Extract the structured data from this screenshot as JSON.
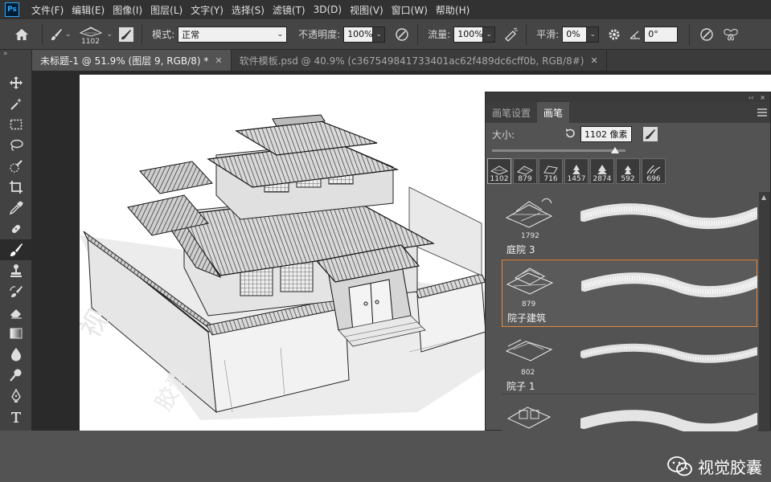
{
  "menubar": {
    "logo": "Ps",
    "items": [
      "文件(F)",
      "编辑(E)",
      "图像(I)",
      "图层(L)",
      "文字(Y)",
      "选择(S)",
      "滤镜(T)",
      "3D(D)",
      "视图(V)",
      "窗口(W)",
      "帮助(H)"
    ]
  },
  "options": {
    "brush_size": "1102",
    "mode_label": "模式:",
    "mode_value": "正常",
    "opacity_label": "不透明度:",
    "opacity_value": "100%",
    "flow_label": "流量:",
    "flow_value": "100%",
    "smooth_label": "平滑:",
    "smooth_value": "0%",
    "angle_value": "0°"
  },
  "tabs": [
    {
      "label": "未标题-1 @ 51.9% (图层 9, RGB/8) *",
      "active": true
    },
    {
      "label": "软件模板.psd @ 40.9% (c367549841733401ac62f489dc6cff0b, RGB/8#)",
      "active": false
    }
  ],
  "toolbar": {
    "collapse": "»",
    "tools": [
      "move-tool",
      "magic-wand-tool",
      "marquee-tool",
      "lasso-tool",
      "quick-selection-tool",
      "crop-tool",
      "eyedropper-tool",
      "healing-brush-tool",
      "brush-tool",
      "clone-stamp-tool",
      "history-brush-tool",
      "eraser-tool",
      "gradient-tool",
      "blur-tool",
      "dodge-tool",
      "pen-tool",
      "type-tool"
    ],
    "active_tool": "brush-tool"
  },
  "panel": {
    "collapse": "‹‹",
    "close": "×",
    "tab_settings": "画笔设置",
    "tab_brushes": "画笔",
    "size_label": "大小:",
    "size_value": "1102 像素",
    "size_fraction": 0.92,
    "presets": [
      "1102",
      "879",
      "716",
      "1457",
      "2874",
      "592",
      "696"
    ],
    "brushes": [
      {
        "num": "1792",
        "name": "庭院 3",
        "selected": false
      },
      {
        "num": "879",
        "name": "院子建筑",
        "selected": true
      },
      {
        "num": "802",
        "name": "院子 1",
        "selected": false
      },
      {
        "num": "",
        "name": "",
        "selected": false
      }
    ]
  },
  "watermark": {
    "text": "视觉胶囊"
  },
  "colors": {
    "accent_selection": "#e8883a",
    "ps_blue": "#31a8ff"
  }
}
